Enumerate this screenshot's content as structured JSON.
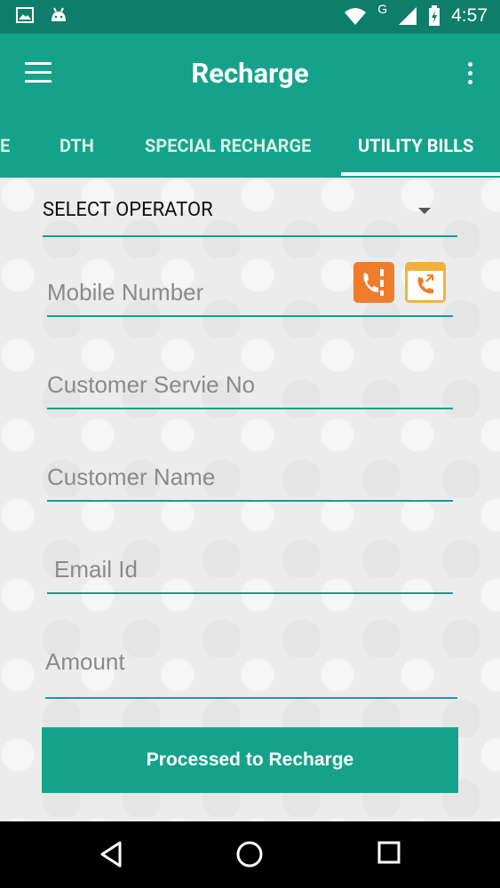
{
  "status": {
    "time": "4:57",
    "net": "G"
  },
  "appbar": {
    "title": "Recharge"
  },
  "tabs": [
    {
      "label": "E"
    },
    {
      "label": "DTH"
    },
    {
      "label": "SPECIAL RECHARGE"
    },
    {
      "label": "UTILITY BILLS"
    }
  ],
  "form": {
    "operator_label": "SELECT OPERATOR",
    "mobile_placeholder": "Mobile Number",
    "service_placeholder": "Customer Servie No",
    "name_placeholder": "Customer Name",
    "email_placeholder": "Email Id",
    "amount_placeholder": "Amount",
    "submit_label": "Processed to Recharge"
  },
  "colors": {
    "primary": "#14a38a",
    "statusbar": "#0e7d6a",
    "accent": "#ef7d2c"
  },
  "icons": [
    "gallery-icon",
    "android-icon",
    "wifi-icon",
    "signal-icon",
    "battery-icon",
    "menu-icon",
    "overflow-icon",
    "contacts-book-icon",
    "call-log-icon",
    "back-icon",
    "home-icon",
    "recents-icon"
  ]
}
